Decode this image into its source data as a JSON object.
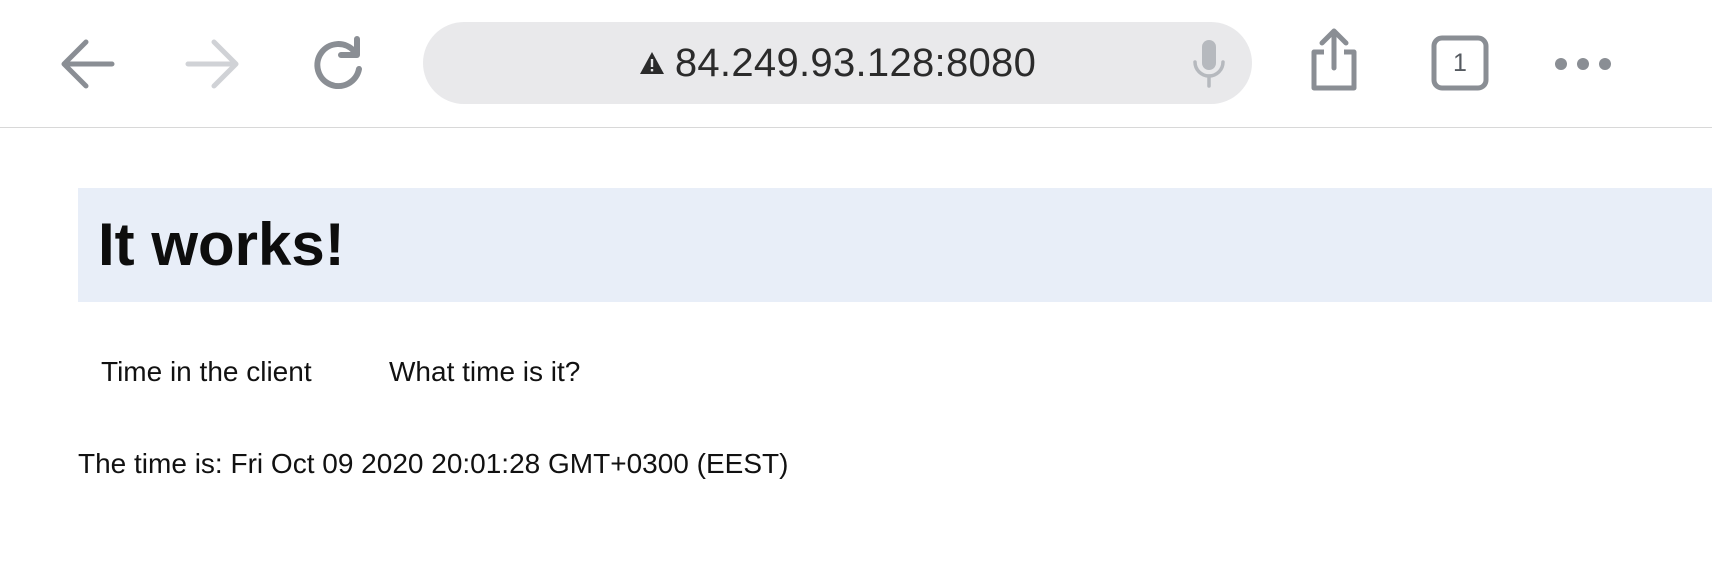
{
  "browser": {
    "url": "84.249.93.128:8080",
    "tab_count": "1",
    "icons": {
      "back": "back-arrow-icon",
      "forward": "forward-arrow-icon",
      "reload": "reload-icon",
      "warning": "warning-triangle-icon",
      "mic": "microphone-icon",
      "share": "share-icon",
      "tabs": "tabs-icon",
      "more": "more-dots-icon"
    },
    "colors": {
      "url_bar_bg": "#e9e9eb",
      "icon_gray": "#8a8e94",
      "icon_disabled": "#d0d2d6"
    }
  },
  "page": {
    "heading": "It works!",
    "buttons": {
      "time_client": "Time in the client",
      "what_time": "What time is it?"
    },
    "time_text": "The time is: Fri Oct 09 2020 20:01:28 GMT+0300 (EEST)",
    "colors": {
      "heading_bg": "#e8eef8"
    }
  }
}
